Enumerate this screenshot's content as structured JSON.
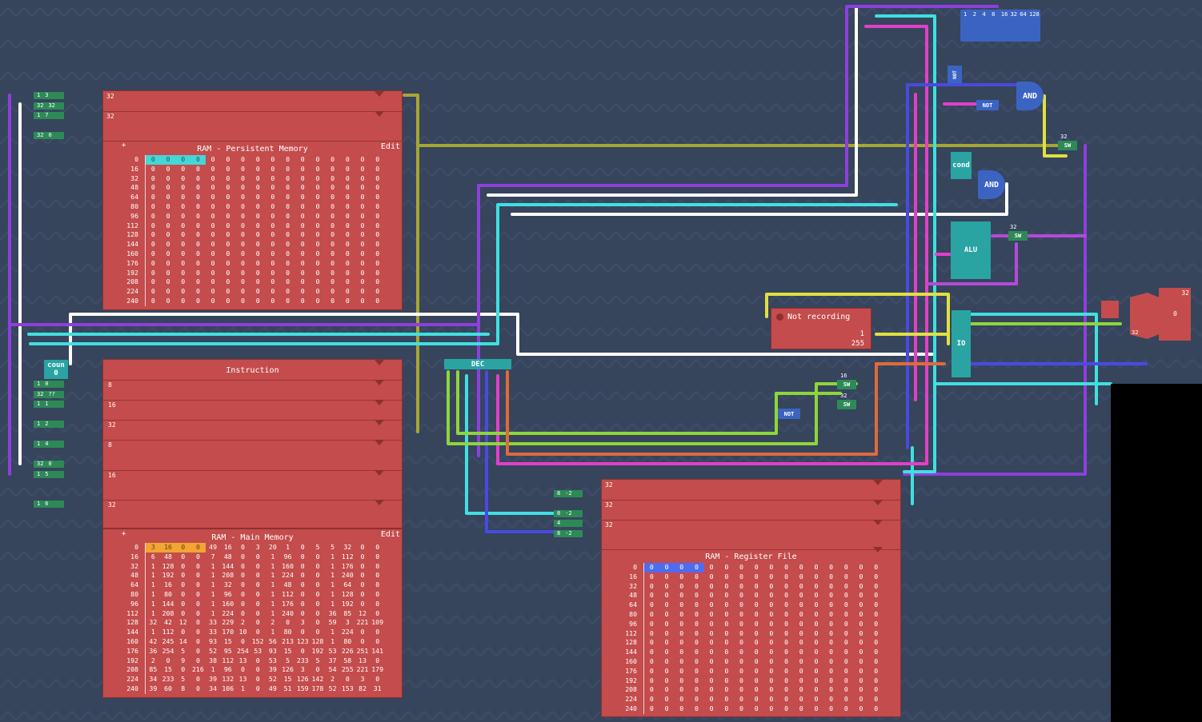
{
  "colors": {
    "background": "#36445c",
    "ram": "#c44c4c",
    "wire_cyan": "#3fe0e0",
    "wire_purple": "#8e3fdc",
    "wire_white": "#ffffff",
    "wire_olive": "#a6a633",
    "wire_magenta": "#e23fc8",
    "wire_blue": "#4a4ae0",
    "wire_green": "#8ed63a",
    "wire_orange": "#e06a3a",
    "wire_yellow": "#e0e040"
  },
  "persistent": {
    "title": "RAM - Persistent Memory",
    "edit": "Edit",
    "pin": "+",
    "addresses": [
      "0",
      "16",
      "32",
      "48",
      "64",
      "80",
      "96",
      "112",
      "128",
      "144",
      "160",
      "176",
      "192",
      "208",
      "224",
      "240"
    ],
    "rows": [
      [
        "0",
        "0",
        "0",
        "0",
        "0",
        "0",
        "0",
        "0",
        "0",
        "0",
        "0",
        "0",
        "0",
        "0",
        "0",
        "0"
      ],
      [
        "0",
        "0",
        "0",
        "0",
        "0",
        "0",
        "0",
        "0",
        "0",
        "0",
        "0",
        "0",
        "0",
        "0",
        "0",
        "0"
      ],
      [
        "0",
        "0",
        "0",
        "0",
        "0",
        "0",
        "0",
        "0",
        "0",
        "0",
        "0",
        "0",
        "0",
        "0",
        "0",
        "0"
      ],
      [
        "0",
        "0",
        "0",
        "0",
        "0",
        "0",
        "0",
        "0",
        "0",
        "0",
        "0",
        "0",
        "0",
        "0",
        "0",
        "0"
      ],
      [
        "0",
        "0",
        "0",
        "0",
        "0",
        "0",
        "0",
        "0",
        "0",
        "0",
        "0",
        "0",
        "0",
        "0",
        "0",
        "0"
      ],
      [
        "0",
        "0",
        "0",
        "0",
        "0",
        "0",
        "0",
        "0",
        "0",
        "0",
        "0",
        "0",
        "0",
        "0",
        "0",
        "0"
      ],
      [
        "0",
        "0",
        "0",
        "0",
        "0",
        "0",
        "0",
        "0",
        "0",
        "0",
        "0",
        "0",
        "0",
        "0",
        "0",
        "0"
      ],
      [
        "0",
        "0",
        "0",
        "0",
        "0",
        "0",
        "0",
        "0",
        "0",
        "0",
        "0",
        "0",
        "0",
        "0",
        "0",
        "0"
      ],
      [
        "0",
        "0",
        "0",
        "0",
        "0",
        "0",
        "0",
        "0",
        "0",
        "0",
        "0",
        "0",
        "0",
        "0",
        "0",
        "0"
      ],
      [
        "0",
        "0",
        "0",
        "0",
        "0",
        "0",
        "0",
        "0",
        "0",
        "0",
        "0",
        "0",
        "0",
        "0",
        "0",
        "0"
      ],
      [
        "0",
        "0",
        "0",
        "0",
        "0",
        "0",
        "0",
        "0",
        "0",
        "0",
        "0",
        "0",
        "0",
        "0",
        "0",
        "0"
      ],
      [
        "0",
        "0",
        "0",
        "0",
        "0",
        "0",
        "0",
        "0",
        "0",
        "0",
        "0",
        "0",
        "0",
        "0",
        "0",
        "0"
      ],
      [
        "0",
        "0",
        "0",
        "0",
        "0",
        "0",
        "0",
        "0",
        "0",
        "0",
        "0",
        "0",
        "0",
        "0",
        "0",
        "0"
      ],
      [
        "0",
        "0",
        "0",
        "0",
        "0",
        "0",
        "0",
        "0",
        "0",
        "0",
        "0",
        "0",
        "0",
        "0",
        "0",
        "0"
      ],
      [
        "0",
        "0",
        "0",
        "0",
        "0",
        "0",
        "0",
        "0",
        "0",
        "0",
        "0",
        "0",
        "0",
        "0",
        "0",
        "0"
      ],
      [
        "0",
        "0",
        "0",
        "0",
        "0",
        "0",
        "0",
        "0",
        "0",
        "0",
        "0",
        "0",
        "0",
        "0",
        "0",
        "0"
      ]
    ],
    "ports": [
      "32",
      "",
      "32"
    ]
  },
  "main": {
    "title": "RAM - Main Memory",
    "edit": "Edit",
    "pin": "+",
    "addresses": [
      "0",
      "16",
      "32",
      "48",
      "64",
      "80",
      "96",
      "112",
      "128",
      "144",
      "160",
      "176",
      "192",
      "208",
      "224",
      "240"
    ],
    "rows": [
      [
        "3",
        "16",
        "0",
        "0",
        "49",
        "16",
        "0",
        "3",
        "20",
        "1",
        "0",
        "5",
        "5",
        "32",
        "0",
        "0"
      ],
      [
        "6",
        "48",
        "0",
        "0",
        "7",
        "48",
        "0",
        "0",
        "1",
        "96",
        "0",
        "0",
        "1",
        "112",
        "0",
        "0"
      ],
      [
        "1",
        "128",
        "0",
        "0",
        "1",
        "144",
        "0",
        "0",
        "1",
        "160",
        "0",
        "0",
        "1",
        "176",
        "0",
        "0"
      ],
      [
        "1",
        "192",
        "0",
        "0",
        "1",
        "208",
        "0",
        "0",
        "1",
        "224",
        "0",
        "0",
        "1",
        "240",
        "0",
        "0"
      ],
      [
        "1",
        "16",
        "0",
        "0",
        "1",
        "32",
        "0",
        "0",
        "1",
        "48",
        "0",
        "0",
        "1",
        "64",
        "0",
        "0"
      ],
      [
        "1",
        "80",
        "0",
        "0",
        "1",
        "96",
        "0",
        "0",
        "1",
        "112",
        "0",
        "0",
        "1",
        "128",
        "0",
        "0"
      ],
      [
        "1",
        "144",
        "0",
        "0",
        "1",
        "160",
        "0",
        "0",
        "1",
        "176",
        "0",
        "0",
        "1",
        "192",
        "0",
        "0"
      ],
      [
        "1",
        "208",
        "0",
        "0",
        "1",
        "224",
        "0",
        "0",
        "1",
        "240",
        "0",
        "0",
        "36",
        "85",
        "12",
        "0"
      ],
      [
        "32",
        "42",
        "12",
        "0",
        "33",
        "229",
        "2",
        "0",
        "2",
        "0",
        "3",
        "0",
        "59",
        "3",
        "221",
        "109"
      ],
      [
        "1",
        "112",
        "0",
        "0",
        "33",
        "170",
        "10",
        "0",
        "1",
        "80",
        "0",
        "0",
        "1",
        "224",
        "0",
        "0"
      ],
      [
        "42",
        "245",
        "14",
        "0",
        "93",
        "15",
        "0",
        "152",
        "56",
        "213",
        "123",
        "128",
        "1",
        "80",
        "0",
        "0"
      ],
      [
        "36",
        "254",
        "5",
        "0",
        "52",
        "95",
        "254",
        "53",
        "93",
        "15",
        "0",
        "192",
        "53",
        "226",
        "251",
        "141"
      ],
      [
        "2",
        "0",
        "9",
        "0",
        "38",
        "112",
        "13",
        "0",
        "53",
        "5",
        "233",
        "5",
        "37",
        "58",
        "13",
        "0"
      ],
      [
        "85",
        "15",
        "0",
        "216",
        "1",
        "96",
        "0",
        "0",
        "39",
        "126",
        "3",
        "0",
        "54",
        "255",
        "221",
        "179"
      ],
      [
        "34",
        "233",
        "5",
        "0",
        "39",
        "132",
        "13",
        "0",
        "52",
        "15",
        "126",
        "142",
        "2",
        "0",
        "3",
        "0"
      ],
      [
        "39",
        "60",
        "8",
        "0",
        "34",
        "106",
        "1",
        "0",
        "49",
        "51",
        "159",
        "178",
        "52",
        "153",
        "82",
        "31"
      ]
    ],
    "ports": [
      "8",
      "16",
      "32",
      "8",
      "16",
      "32"
    ]
  },
  "instruction": {
    "title": "Instruction"
  },
  "regfile": {
    "title": "RAM - Register File",
    "addresses": [
      "0",
      "16",
      "32",
      "48",
      "64",
      "80",
      "96",
      "112",
      "128",
      "144",
      "160",
      "176",
      "192",
      "208",
      "224",
      "240"
    ],
    "rows": [
      [
        "0",
        "0",
        "0",
        "0",
        "0",
        "0",
        "0",
        "0",
        "0",
        "0",
        "0",
        "0",
        "0",
        "0",
        "0",
        "0"
      ],
      [
        "0",
        "0",
        "0",
        "0",
        "0",
        "0",
        "0",
        "0",
        "0",
        "0",
        "0",
        "0",
        "0",
        "0",
        "0",
        "0"
      ],
      [
        "0",
        "0",
        "0",
        "0",
        "0",
        "0",
        "0",
        "0",
        "0",
        "0",
        "0",
        "0",
        "0",
        "0",
        "0",
        "0"
      ],
      [
        "0",
        "0",
        "0",
        "0",
        "0",
        "0",
        "0",
        "0",
        "0",
        "0",
        "0",
        "0",
        "0",
        "0",
        "0",
        "0"
      ],
      [
        "0",
        "0",
        "0",
        "0",
        "0",
        "0",
        "0",
        "0",
        "0",
        "0",
        "0",
        "0",
        "0",
        "0",
        "0",
        "0"
      ],
      [
        "0",
        "0",
        "0",
        "0",
        "0",
        "0",
        "0",
        "0",
        "0",
        "0",
        "0",
        "0",
        "0",
        "0",
        "0",
        "0"
      ],
      [
        "0",
        "0",
        "0",
        "0",
        "0",
        "0",
        "0",
        "0",
        "0",
        "0",
        "0",
        "0",
        "0",
        "0",
        "0",
        "0"
      ],
      [
        "0",
        "0",
        "0",
        "0",
        "0",
        "0",
        "0",
        "0",
        "0",
        "0",
        "0",
        "0",
        "0",
        "0",
        "0",
        "0"
      ],
      [
        "0",
        "0",
        "0",
        "0",
        "0",
        "0",
        "0",
        "0",
        "0",
        "0",
        "0",
        "0",
        "0",
        "0",
        "0",
        "0"
      ],
      [
        "0",
        "0",
        "0",
        "0",
        "0",
        "0",
        "0",
        "0",
        "0",
        "0",
        "0",
        "0",
        "0",
        "0",
        "0",
        "0"
      ],
      [
        "0",
        "0",
        "0",
        "0",
        "0",
        "0",
        "0",
        "0",
        "0",
        "0",
        "0",
        "0",
        "0",
        "0",
        "0",
        "0"
      ],
      [
        "0",
        "0",
        "0",
        "0",
        "0",
        "0",
        "0",
        "0",
        "0",
        "0",
        "0",
        "0",
        "0",
        "0",
        "0",
        "0"
      ],
      [
        "0",
        "0",
        "0",
        "0",
        "0",
        "0",
        "0",
        "0",
        "0",
        "0",
        "0",
        "0",
        "0",
        "0",
        "0",
        "0"
      ],
      [
        "0",
        "0",
        "0",
        "0",
        "0",
        "0",
        "0",
        "0",
        "0",
        "0",
        "0",
        "0",
        "0",
        "0",
        "0",
        "0"
      ],
      [
        "0",
        "0",
        "0",
        "0",
        "0",
        "0",
        "0",
        "0",
        "0",
        "0",
        "0",
        "0",
        "0",
        "0",
        "0",
        "0"
      ],
      [
        "0",
        "0",
        "0",
        "0",
        "0",
        "0",
        "0",
        "0",
        "0",
        "0",
        "0",
        "0",
        "0",
        "0",
        "0",
        "0"
      ]
    ],
    "ports": [
      "32",
      "32",
      "32"
    ]
  },
  "components": {
    "and1": "AND",
    "and2": "AND",
    "not1": "NOT",
    "not2": "NOT",
    "not3": "NOT",
    "cond": "cond",
    "alu": "ALU",
    "dec": "DEC",
    "io": "IO",
    "counter": "coun",
    "counter_value": "0",
    "sw": "SW",
    "sw_width": "32",
    "sw_width2": "16",
    "sw_width3": "32",
    "sw_width4": "32"
  },
  "recorder": {
    "status": "Not recording",
    "value1": "1",
    "value2": "255"
  },
  "bit_labels": [
    "1",
    "2",
    "4",
    "8",
    "16",
    "32",
    "64",
    "128"
  ],
  "left_inputs": [
    [
      "1",
      "3"
    ],
    [
      "32",
      "32"
    ],
    [
      "1",
      "7"
    ],
    [
      "32",
      "0"
    ],
    [
      "1",
      "0"
    ],
    [
      "32",
      "??"
    ],
    [
      "1",
      "1"
    ],
    [
      "1",
      "2"
    ],
    [
      "1",
      "4"
    ],
    [
      "32",
      "0"
    ],
    [
      "1",
      "5"
    ],
    [
      "1",
      "6"
    ]
  ],
  "reg_inputs": [
    [
      "8",
      "-2"
    ],
    [
      "8",
      "-2"
    ],
    [
      "4"
    ],
    [
      "8",
      "-2"
    ]
  ],
  "far_right": {
    "label32": "32",
    "zero": "0",
    "label32b": "32"
  }
}
